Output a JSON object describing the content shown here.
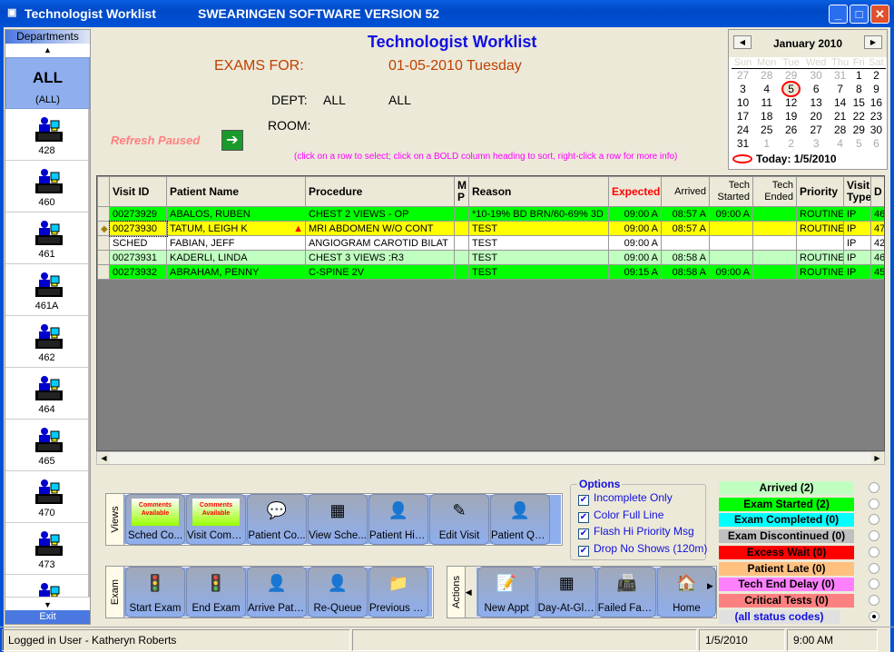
{
  "window": {
    "title": "Technologist Worklist",
    "version": "SWEARINGEN SOFTWARE VERSION 52"
  },
  "sidebar": {
    "header": "Departments",
    "all_label": "ALL",
    "all_sub": "(ALL)",
    "exit": "Exit",
    "items": [
      "428",
      "460",
      "461",
      "461A",
      "462",
      "464",
      "465",
      "470",
      "473"
    ]
  },
  "header": {
    "title": "Technologist Worklist",
    "exams_for_label": "EXAMS FOR:",
    "date": "01-05-2010 Tuesday",
    "dept_label": "DEPT:",
    "dept_value1": "ALL",
    "dept_value2": "ALL",
    "room_label": "ROOM:",
    "refresh": "Refresh Paused",
    "hint": "(click on a row to select; click on a BOLD column heading to sort, right-click a row for more info)"
  },
  "calendar": {
    "month": "January 2010",
    "days": [
      "Sun",
      "Mon",
      "Tue",
      "Wed",
      "Thu",
      "Fri",
      "Sat"
    ],
    "weeks": [
      [
        "27",
        "28",
        "29",
        "30",
        "31",
        "1",
        "2"
      ],
      [
        "3",
        "4",
        "5",
        "6",
        "7",
        "8",
        "9"
      ],
      [
        "10",
        "11",
        "12",
        "13",
        "14",
        "15",
        "16"
      ],
      [
        "17",
        "18",
        "19",
        "20",
        "21",
        "22",
        "23"
      ],
      [
        "24",
        "25",
        "26",
        "27",
        "28",
        "29",
        "30"
      ],
      [
        "31",
        "1",
        "2",
        "3",
        "4",
        "5",
        "6"
      ]
    ],
    "selected": "5",
    "today": "Today: 1/5/2010"
  },
  "grid": {
    "columns": [
      "Visit ID",
      "Patient Name",
      "Procedure",
      "M P",
      "Reason",
      "Expected",
      "Arrived",
      "Tech Started",
      "Tech Ended",
      "Priority",
      "Visit Type",
      "D"
    ],
    "rows": [
      {
        "color": "#00ff00",
        "cells": [
          "00273929",
          "ABALOS, RUBEN",
          "CHEST 2 VIEWS - OP",
          "",
          "*10-19% BD BRN/60-69% 3D",
          "09:00 A",
          "08:57 A",
          "09:00 A",
          "",
          "ROUTINE",
          "IP",
          "46"
        ]
      },
      {
        "color": "#ffff00",
        "warning": true,
        "selected": true,
        "cells": [
          "00273930",
          "TATUM, LEIGH K",
          "MRI ABDOMEN W/O CONT",
          "",
          "TEST",
          "09:00 A",
          "08:57 A",
          "",
          "",
          "ROUTINE",
          "IP",
          "47"
        ]
      },
      {
        "color": "#ffffff",
        "cells": [
          "SCHED",
          "FABIAN, JEFF",
          "ANGIOGRAM CAROTID BILAT",
          "",
          "TEST",
          "09:00 A",
          "",
          "",
          "",
          "",
          "IP",
          "42"
        ]
      },
      {
        "color": "#c0ffc0",
        "cells": [
          "00273931",
          "KADERLI, LINDA",
          "CHEST 3 VIEWS :R3",
          "",
          "TEST",
          "09:00 A",
          "08:58 A",
          "",
          "",
          "ROUTINE",
          "IP",
          "46"
        ]
      },
      {
        "color": "#00ff00",
        "cells": [
          "00273932",
          "ABRAHAM, PENNY",
          "C-SPINE 2V",
          "",
          "TEST",
          "09:15 A",
          "08:58 A",
          "09:00 A",
          "",
          "ROUTINE",
          "IP",
          "45"
        ]
      }
    ]
  },
  "views": {
    "label": "Views",
    "buttons": [
      "Sched Co...",
      "Visit Comm...",
      "Patient Co...",
      "View Sche...",
      "Patient Hist...",
      "Edit Visit",
      "Patient Qui..."
    ],
    "comments_badge": "Comments Available"
  },
  "exam": {
    "label": "Exam",
    "buttons": [
      "Start Exam",
      "End Exam",
      "Arrive Patient",
      "Re-Queue",
      "Previous R..."
    ]
  },
  "actions": {
    "label": "Actions",
    "buttons": [
      "New Appt",
      "Day-At-Gla...",
      "Failed Faxes",
      "Home"
    ]
  },
  "options": {
    "label": "Options",
    "items": [
      {
        "label": "Incomplete Only",
        "checked": true
      },
      {
        "label": "Color Full Line",
        "checked": true
      },
      {
        "label": "Flash Hi Priority Msg",
        "checked": true
      },
      {
        "label": "Drop No Shows (120m)",
        "checked": true
      }
    ]
  },
  "status_codes": [
    {
      "label": "Arrived (2)",
      "color": "#c0ffc0",
      "text": "#000"
    },
    {
      "label": "Exam Started (2)",
      "color": "#00ff00",
      "text": "#000"
    },
    {
      "label": "Exam Completed (0)",
      "color": "#00ffff",
      "text": "#000"
    },
    {
      "label": "Exam Discontinued (0)",
      "color": "#c0c0c0",
      "text": "#000"
    },
    {
      "label": "Excess Wait (0)",
      "color": "#ff0000",
      "text": "#000"
    },
    {
      "label": "Patient Late (0)",
      "color": "#ffc080",
      "text": "#000"
    },
    {
      "label": "Tech End Delay (0)",
      "color": "#ff80ff",
      "text": "#000"
    },
    {
      "label": "Critical Tests (0)",
      "color": "#ff8080",
      "text": "#000"
    },
    {
      "label": "(all status codes)",
      "color": "#e0e0e0",
      "text": "#1010e0",
      "selected": true
    }
  ],
  "statusbar": {
    "user": "Logged in User - Katheryn  Roberts",
    "date": "1/5/2010",
    "time": "9:00 AM"
  }
}
